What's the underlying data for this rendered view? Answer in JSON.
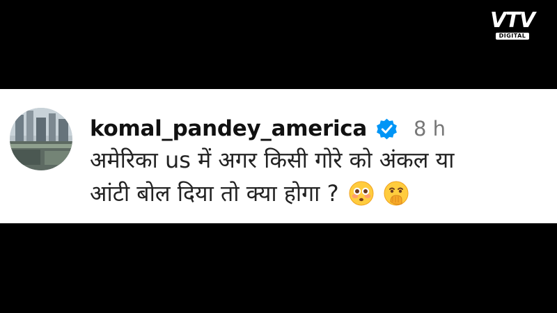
{
  "brand": {
    "logo_text": "VTV",
    "logo_subtext": "DIGITAL"
  },
  "comment": {
    "username": "komal_pandey_america",
    "verified": true,
    "time": "8 h",
    "text_line1": "अमेरिका us में अगर किसी गोरे को अंकल या",
    "text_line2": "आंटी बोल दिया तो क्या होगा ?",
    "emojis": [
      "flushed-face-icon",
      "face-with-hand-over-mouth-icon"
    ]
  },
  "colors": {
    "background": "#000000",
    "comment_bg": "#ffffff",
    "verified_blue": "#0095f6",
    "text": "#222222",
    "muted": "#777777"
  }
}
